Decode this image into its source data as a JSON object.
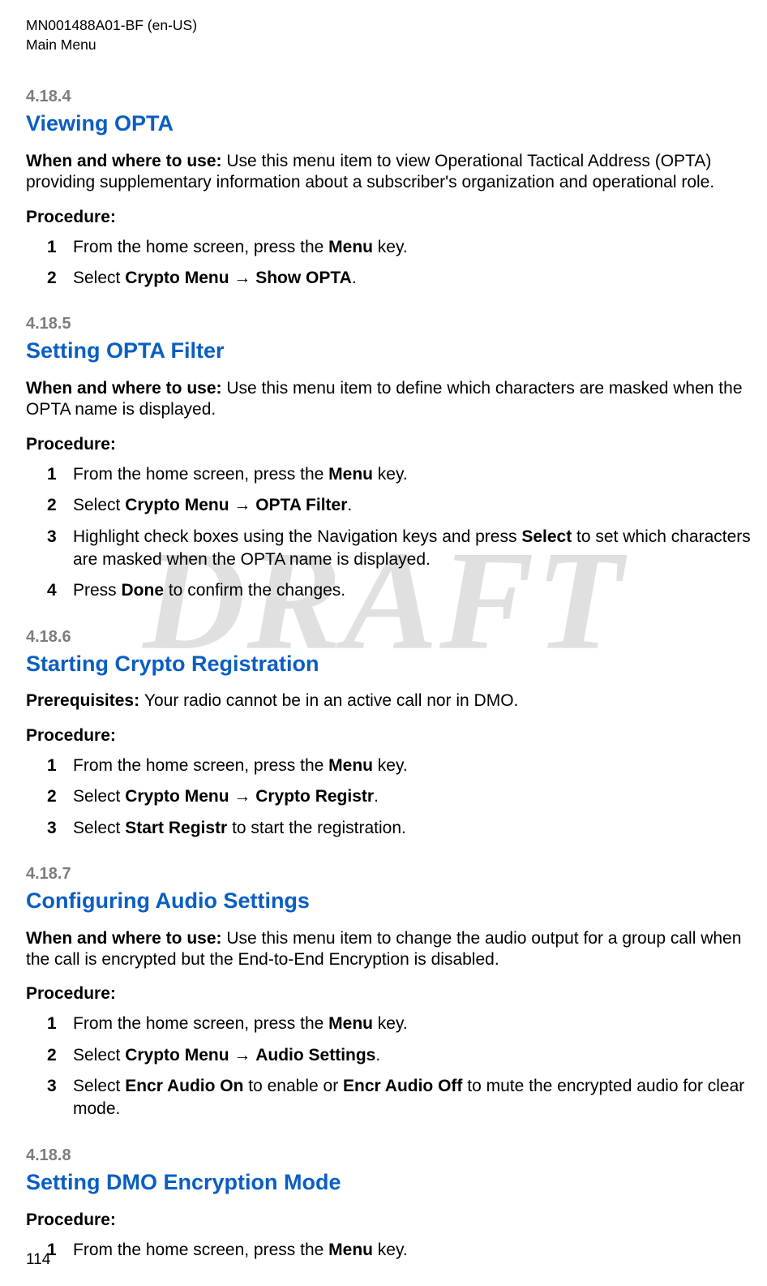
{
  "header": {
    "doc_id": "MN001488A01-BF (en-US)",
    "chapter": "Main Menu"
  },
  "watermark": "DRAFT",
  "page_number": "114",
  "labels": {
    "when_and_where": "When and where to use: ",
    "prerequisites": "Prerequisites: ",
    "procedure": "Procedure:"
  },
  "common": {
    "menu_key_prefix": "From the home screen, press the ",
    "menu_key_bold": "Menu",
    "menu_key_suffix": " key.",
    "select_prefix": "Select ",
    "arrow": " → "
  },
  "sections": [
    {
      "number": "4.18.4",
      "title": "Viewing OPTA",
      "when_where": "Use this menu item to view Operational Tactical Address (OPTA) providing supplementary information about a subscriber's organization and operational role.",
      "steps": {
        "s2_bold1": "Crypto Menu",
        "s2_bold2": "Show OPTA",
        "s2_suffix": "."
      }
    },
    {
      "number": "4.18.5",
      "title": "Setting OPTA Filter",
      "when_where": "Use this menu item to define which characters are masked when the OPTA name is displayed.",
      "steps": {
        "s2_bold1": "Crypto Menu",
        "s2_bold2": "OPTA Filter",
        "s2_suffix": ".",
        "s3_pre": "Highlight check boxes using the Navigation keys and press ",
        "s3_bold": "Select",
        "s3_post": " to set which characters are masked when the OPTA name is displayed.",
        "s4_pre": "Press ",
        "s4_bold": "Done",
        "s4_post": " to confirm the changes."
      }
    },
    {
      "number": "4.18.6",
      "title": "Starting Crypto Registration",
      "prereq": "Your radio cannot be in an active call nor in DMO.",
      "steps": {
        "s2_bold1": "Crypto Menu",
        "s2_bold2": "Crypto Registr",
        "s2_suffix": ".",
        "s3_pre": "Select ",
        "s3_bold": "Start Registr",
        "s3_post": " to start the registration."
      }
    },
    {
      "number": "4.18.7",
      "title": "Configuring Audio Settings",
      "when_where": "Use this menu item to change the audio output for a group call when the call is encrypted but the End-to-End Encryption is disabled.",
      "steps": {
        "s2_bold1": "Crypto Menu",
        "s2_bold2": "Audio Settings",
        "s2_suffix": ".",
        "s3_pre": "Select ",
        "s3_bold1": "Encr Audio On",
        "s3_mid": " to enable or ",
        "s3_bold2": "Encr Audio Off",
        "s3_post": " to mute the encrypted audio for clear mode."
      }
    },
    {
      "number": "4.18.8",
      "title": "Setting DMO Encryption Mode",
      "steps": {}
    }
  ]
}
